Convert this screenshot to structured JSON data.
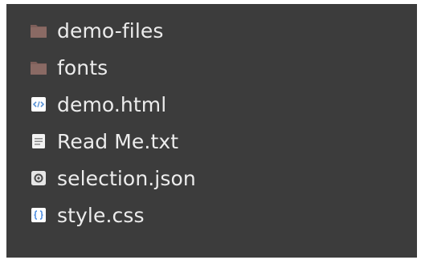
{
  "file_list": {
    "items": [
      {
        "name": "demo-files",
        "icon": "folder-icon"
      },
      {
        "name": "fonts",
        "icon": "folder-icon"
      },
      {
        "name": "demo.html",
        "icon": "html-file-icon"
      },
      {
        "name": "Read Me.txt",
        "icon": "text-file-icon"
      },
      {
        "name": "selection.json",
        "icon": "json-file-icon"
      },
      {
        "name": "style.css",
        "icon": "css-file-icon"
      }
    ]
  },
  "colors": {
    "background": "#3c3c3c",
    "text": "#ececec",
    "folder": "#8a6a64",
    "html_icon": "#5a93d6",
    "css_icon": "#4a8be0"
  }
}
